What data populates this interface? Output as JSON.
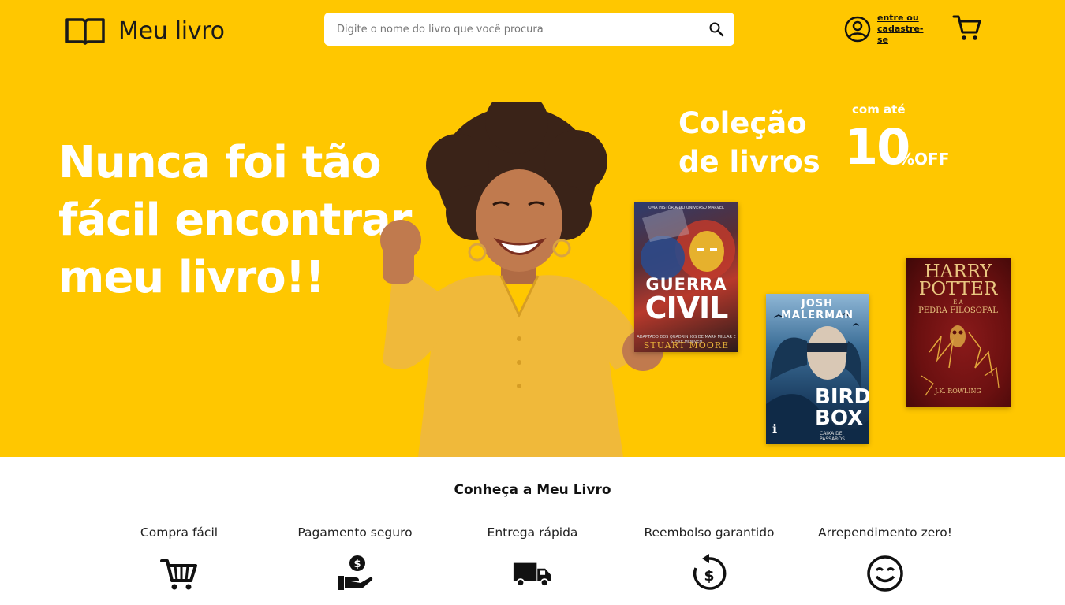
{
  "header": {
    "logo_text": "Meu livro",
    "search": {
      "placeholder": "Digite o nome do livro que você procura"
    },
    "account_link": "entre ou cadastre-se",
    "icons": {
      "logo": "open-book-icon",
      "search": "search-icon",
      "account": "user-circle-icon",
      "cart": "cart-icon"
    }
  },
  "hero": {
    "headline_lines": [
      "Nunca foi tão",
      "fácil encontrar",
      "meu livro!!"
    ],
    "promo": {
      "title_lines": [
        "Coleção",
        "de livros"
      ],
      "pre": "com até",
      "value": "10",
      "suffix": "%OFF"
    },
    "books": [
      {
        "top_text": "UMA HISTÓRIA DO UNIVERSO MARVEL",
        "title_line1": "GUERRA",
        "title_line2": "CIVIL",
        "subtitle": "ADAPTADO DOS QUADRINHOS DE MARK MILLAR E STEVE McNIVEN",
        "author": "STUART MOORE"
      },
      {
        "author": "JOSH MALERMAN",
        "title_line1": "BIRD",
        "title_line2": "BOX",
        "subtitle": "CAIXA DE PÁSSAROS",
        "publisher": "i"
      },
      {
        "title_line1": "HARRY",
        "title_line2": "POTTER",
        "subtitle_line1": "E A",
        "subtitle_line2": "PEDRA FILOSOFAL",
        "author": "J.K. ROWLING"
      }
    ],
    "colors": {
      "background": "#ffc700",
      "text": "#ffffff"
    }
  },
  "features": {
    "title": "Conheça a Meu Livro",
    "items": [
      {
        "label": "Compra fácil",
        "icon": "cart-icon"
      },
      {
        "label": "Pagamento seguro",
        "icon": "money-hand-icon"
      },
      {
        "label": "Entrega rápida",
        "icon": "truck-icon"
      },
      {
        "label": "Reembolso garantido",
        "icon": "refund-icon"
      },
      {
        "label": "Arrependimento zero!",
        "icon": "smiley-icon"
      }
    ]
  }
}
